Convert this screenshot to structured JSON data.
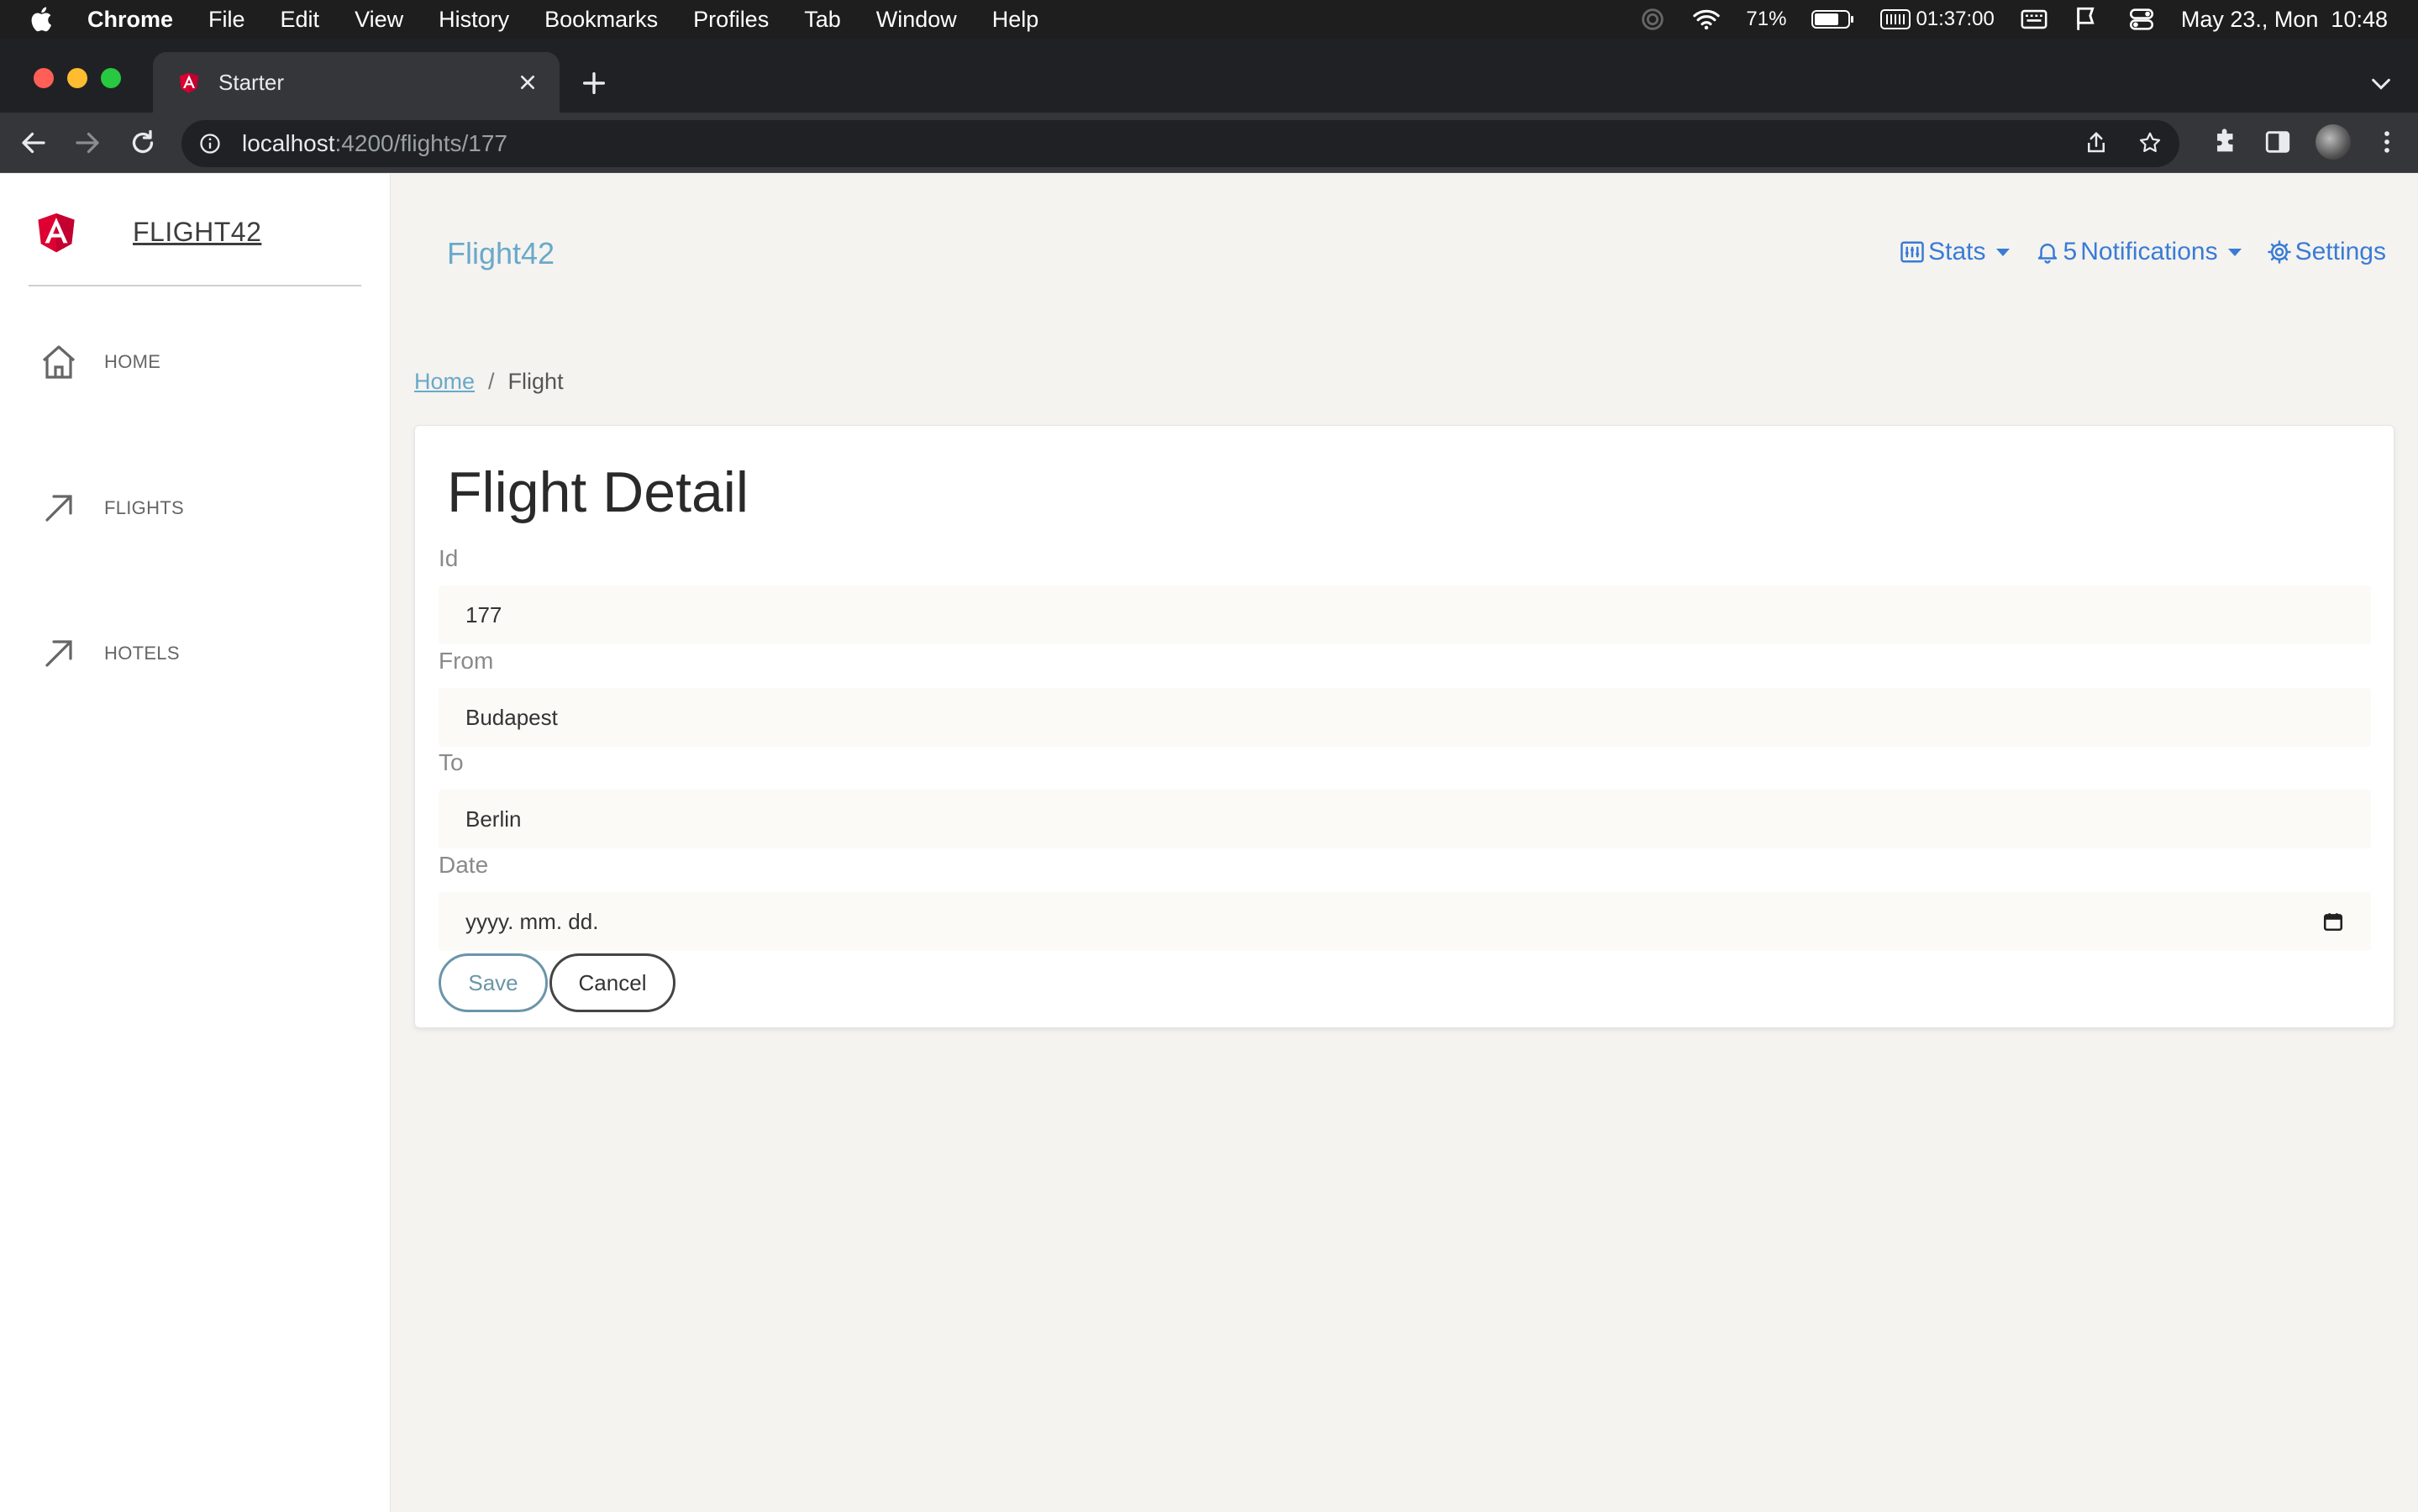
{
  "menubar": {
    "app_name": "Chrome",
    "items": [
      "File",
      "Edit",
      "View",
      "History",
      "Bookmarks",
      "Profiles",
      "Tab",
      "Window",
      "Help"
    ],
    "battery": "71%",
    "timer": "01:37:00",
    "datetime": "May 23., Mon  10:48"
  },
  "browser": {
    "tab_title": "Starter",
    "url_host": "localhost",
    "url_path": ":4200/flights/177"
  },
  "sidebar": {
    "brand": "FLIGHT42",
    "items": [
      {
        "label": "HOME",
        "icon": "home-icon"
      },
      {
        "label": "FLIGHTS",
        "icon": "arrow-up-right-icon"
      },
      {
        "label": "HOTELS",
        "icon": "arrow-up-right-icon"
      }
    ]
  },
  "header": {
    "title": "Flight42",
    "stats_label": "Stats",
    "notifications_count": "5",
    "notifications_label": "Notifications",
    "settings_label": "Settings"
  },
  "breadcrumb": {
    "home": "Home",
    "separator": "/",
    "current": "Flight"
  },
  "form": {
    "title": "Flight Detail",
    "fields": [
      {
        "label": "Id",
        "value": "177"
      },
      {
        "label": "From",
        "value": "Budapest"
      },
      {
        "label": "To",
        "value": "Berlin"
      },
      {
        "label": "Date",
        "placeholder": "yyyy. mm. dd."
      }
    ],
    "save_label": "Save",
    "cancel_label": "Cancel"
  },
  "colors": {
    "accent_link": "#6aa9c8",
    "nav_blue": "#3a7bd5",
    "angular_red": "#dd0031"
  }
}
